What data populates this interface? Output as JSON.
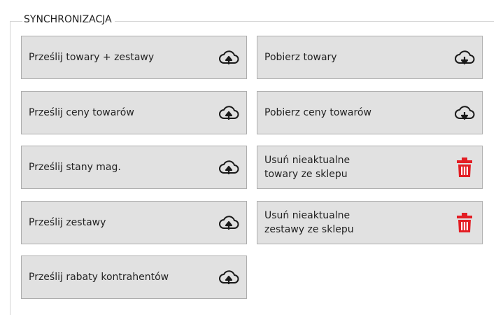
{
  "group": {
    "title": "SYNCHRONIZACJA"
  },
  "buttons": {
    "upload_products_sets": {
      "label": "Prześlij towary + zestawy",
      "icon": "cloud-upload-icon"
    },
    "upload_prices": {
      "label": "Prześlij ceny towarów",
      "icon": "cloud-upload-icon"
    },
    "upload_stock": {
      "label": "Prześlij stany mag.",
      "icon": "cloud-upload-icon"
    },
    "upload_sets": {
      "label": "Prześlij zestawy",
      "icon": "cloud-upload-icon"
    },
    "upload_discounts": {
      "label": "Prześlij rabaty kontrahentów",
      "icon": "cloud-upload-icon"
    },
    "download_products": {
      "label": "Pobierz towary",
      "icon": "cloud-download-icon"
    },
    "download_prices": {
      "label": "Pobierz ceny towarów",
      "icon": "cloud-download-icon"
    },
    "delete_outdated_products": {
      "label": "Usuń nieaktualne\ntowary ze sklepu",
      "icon": "trash-icon"
    },
    "delete_outdated_sets": {
      "label": "Usuń nieaktualne\nzestawy ze sklepu",
      "icon": "trash-icon"
    }
  },
  "colors": {
    "button_bg": "#e1e1e1",
    "button_border": "#adadad",
    "trash_red": "#e31e24"
  }
}
